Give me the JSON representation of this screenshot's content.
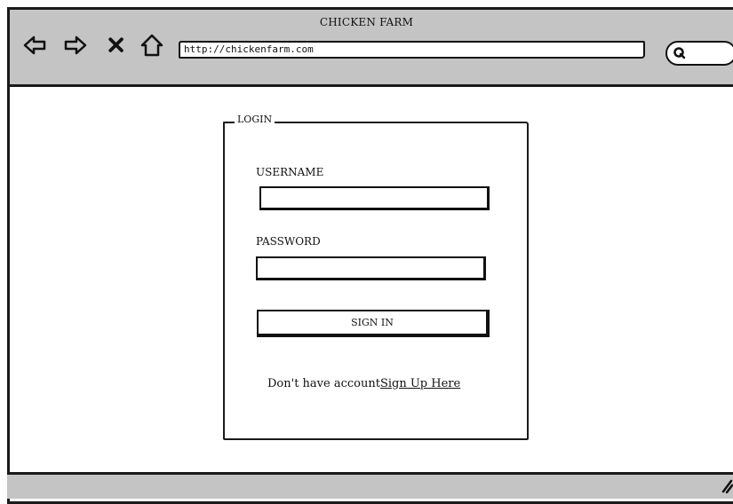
{
  "window": {
    "title": "CHICKEN FARM"
  },
  "toolbar": {
    "back_icon": "left-arrow-icon",
    "forward_icon": "right-arrow-icon",
    "stop_icon": "close-x-icon",
    "home_icon": "home-icon",
    "url": "http://chickenfarm.com",
    "search_icon": "search-icon"
  },
  "login": {
    "legend": "LOGIN",
    "username_label": "USERNAME",
    "username_value": "",
    "password_label": "PASSWORD",
    "password_value": "",
    "signin_label": "SIGN IN",
    "no_account_text": "Don't have account",
    "signup_link": "Sign Up Here"
  },
  "colors": {
    "chrome": "#c4c4c4",
    "outline": "#1a1a1a",
    "background": "#ffffff"
  }
}
